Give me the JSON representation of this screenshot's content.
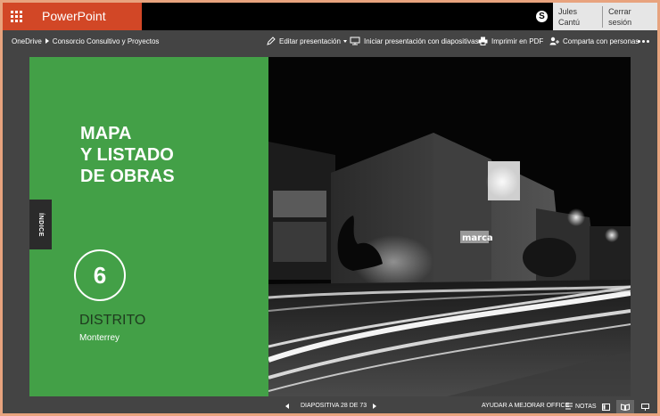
{
  "app": {
    "title": "PowerPoint Online",
    "brand_color": "#d24726"
  },
  "user": {
    "name": "Jules Cantú",
    "signout_label": "Cerrar sesión",
    "skype_icon": "skype-icon"
  },
  "breadcrumb": {
    "root": "OneDrive",
    "folder": "Consorcio Consultivo y Proyectos"
  },
  "commands": {
    "edit": "Editar presentación",
    "slideshow": "Iniciar presentación con diapositivas",
    "print": "Imprimir en PDF",
    "share": "Comparta con personas"
  },
  "slide": {
    "title_lines": [
      "MAPA",
      "Y LISTADO",
      "DE OBRAS"
    ],
    "index_tab": "ÍNDICE",
    "district_number": "6",
    "district_label": "DISTRITO",
    "city": "Monterrey",
    "panel_color": "#43a047",
    "photo_sign": "marca"
  },
  "status": {
    "slide_counter": "DIAPOSITIVA 28 DE 73",
    "help_improve": "AYUDAR A MEJORAR OFFICE",
    "notes": "NOTAS"
  }
}
